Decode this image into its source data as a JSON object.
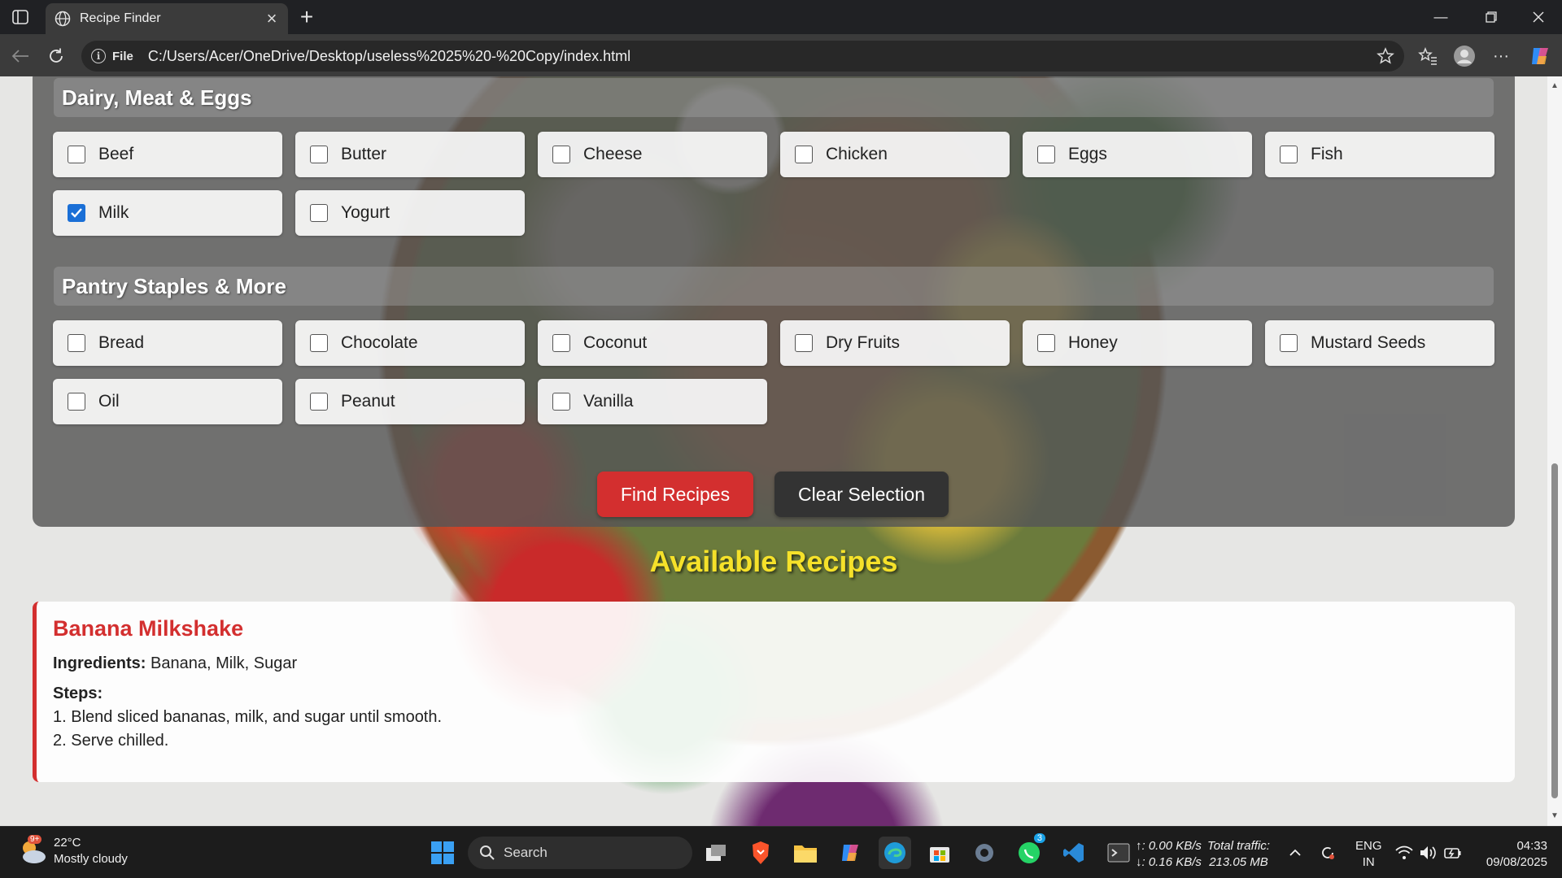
{
  "browser": {
    "tab_title": "Recipe Finder",
    "url_scheme": "File",
    "url": "C:/Users/Acer/OneDrive/Desktop/useless%2025%20-%20Copy/index.html"
  },
  "page": {
    "sections": [
      {
        "title": "Dairy, Meat & Eggs",
        "items": [
          {
            "label": "Beef",
            "checked": false
          },
          {
            "label": "Butter",
            "checked": false
          },
          {
            "label": "Cheese",
            "checked": false
          },
          {
            "label": "Chicken",
            "checked": false
          },
          {
            "label": "Eggs",
            "checked": false
          },
          {
            "label": "Fish",
            "checked": false
          },
          {
            "label": "Milk",
            "checked": true
          },
          {
            "label": "Yogurt",
            "checked": false
          }
        ]
      },
      {
        "title": "Pantry Staples & More",
        "items": [
          {
            "label": "Bread",
            "checked": false
          },
          {
            "label": "Chocolate",
            "checked": false
          },
          {
            "label": "Coconut",
            "checked": false
          },
          {
            "label": "Dry Fruits",
            "checked": false
          },
          {
            "label": "Honey",
            "checked": false
          },
          {
            "label": "Mustard Seeds",
            "checked": false
          },
          {
            "label": "Oil",
            "checked": false
          },
          {
            "label": "Peanut",
            "checked": false
          },
          {
            "label": "Vanilla",
            "checked": false
          }
        ]
      }
    ],
    "find_button": "Find Recipes",
    "clear_button": "Clear Selection",
    "recipes_heading": "Available Recipes",
    "recipe": {
      "name": "Banana Milkshake",
      "ingredients_label": "Ingredients:",
      "ingredients": "Banana, Milk, Sugar",
      "steps_label": "Steps:",
      "steps": [
        "1. Blend sliced bananas, milk, and sugar until smooth.",
        "2. Serve chilled."
      ]
    }
  },
  "taskbar": {
    "weather_temp": "22°C",
    "weather_desc": "Mostly cloudy",
    "weather_badge": "9+",
    "search_label": "Search",
    "whatsapp_badge": "3",
    "net_up": "0.00 KB/s",
    "net_down": "0.16 KB/s",
    "traffic_label": "Total traffic:",
    "traffic_value": "213.05 MB",
    "lang_line1": "ENG",
    "lang_line2": "IN",
    "time": "04:33",
    "date": "09/08/2025"
  },
  "colors": {
    "accent_red": "#d32f2f",
    "heading_yellow": "#f5e12a",
    "checkbox_blue": "#1a6fd6"
  }
}
